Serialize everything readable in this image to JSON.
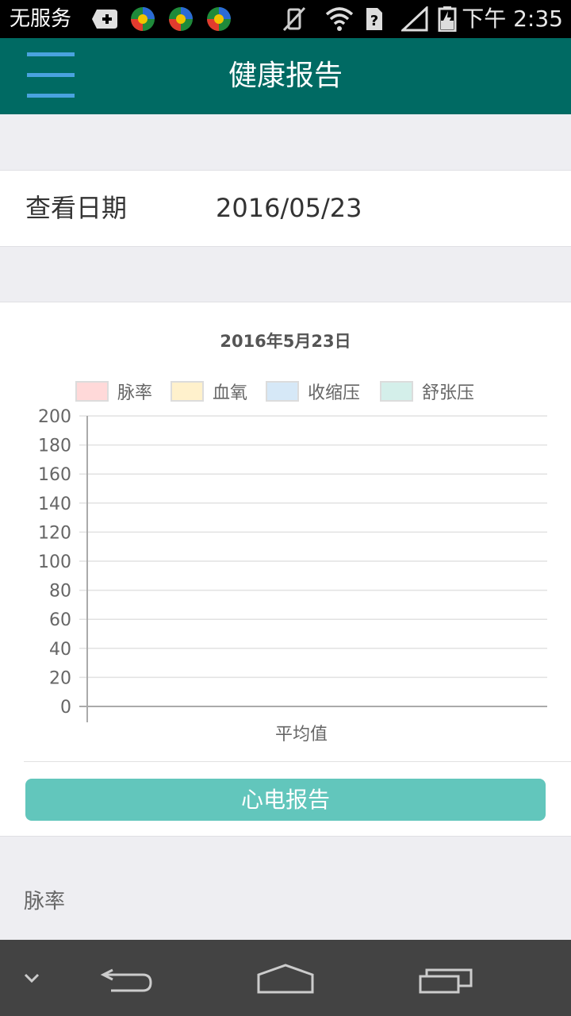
{
  "status_bar": {
    "carrier": "无服务",
    "time": "下午 2:35"
  },
  "app_bar": {
    "title": "健康报告"
  },
  "date_row": {
    "label": "查看日期",
    "value": "2016/05/23"
  },
  "chart_data": {
    "type": "bar",
    "title": "2016年5月23日",
    "categories": [
      "平均值"
    ],
    "series": [
      {
        "name": "脉率",
        "values": [
          null
        ],
        "color": "#ffd9d9"
      },
      {
        "name": "血氧",
        "values": [
          null
        ],
        "color": "#fff1cc"
      },
      {
        "name": "收缩压",
        "values": [
          null
        ],
        "color": "#d6e8f7"
      },
      {
        "name": "舒张压",
        "values": [
          null
        ],
        "color": "#d4efea"
      }
    ],
    "ylim": [
      0,
      200
    ],
    "yticks": [
      0,
      20,
      40,
      60,
      80,
      100,
      120,
      140,
      160,
      180,
      200
    ],
    "grid": true,
    "legend_position": "top"
  },
  "ecg_button": {
    "label": "心电报告"
  },
  "section": {
    "label": "脉率"
  }
}
